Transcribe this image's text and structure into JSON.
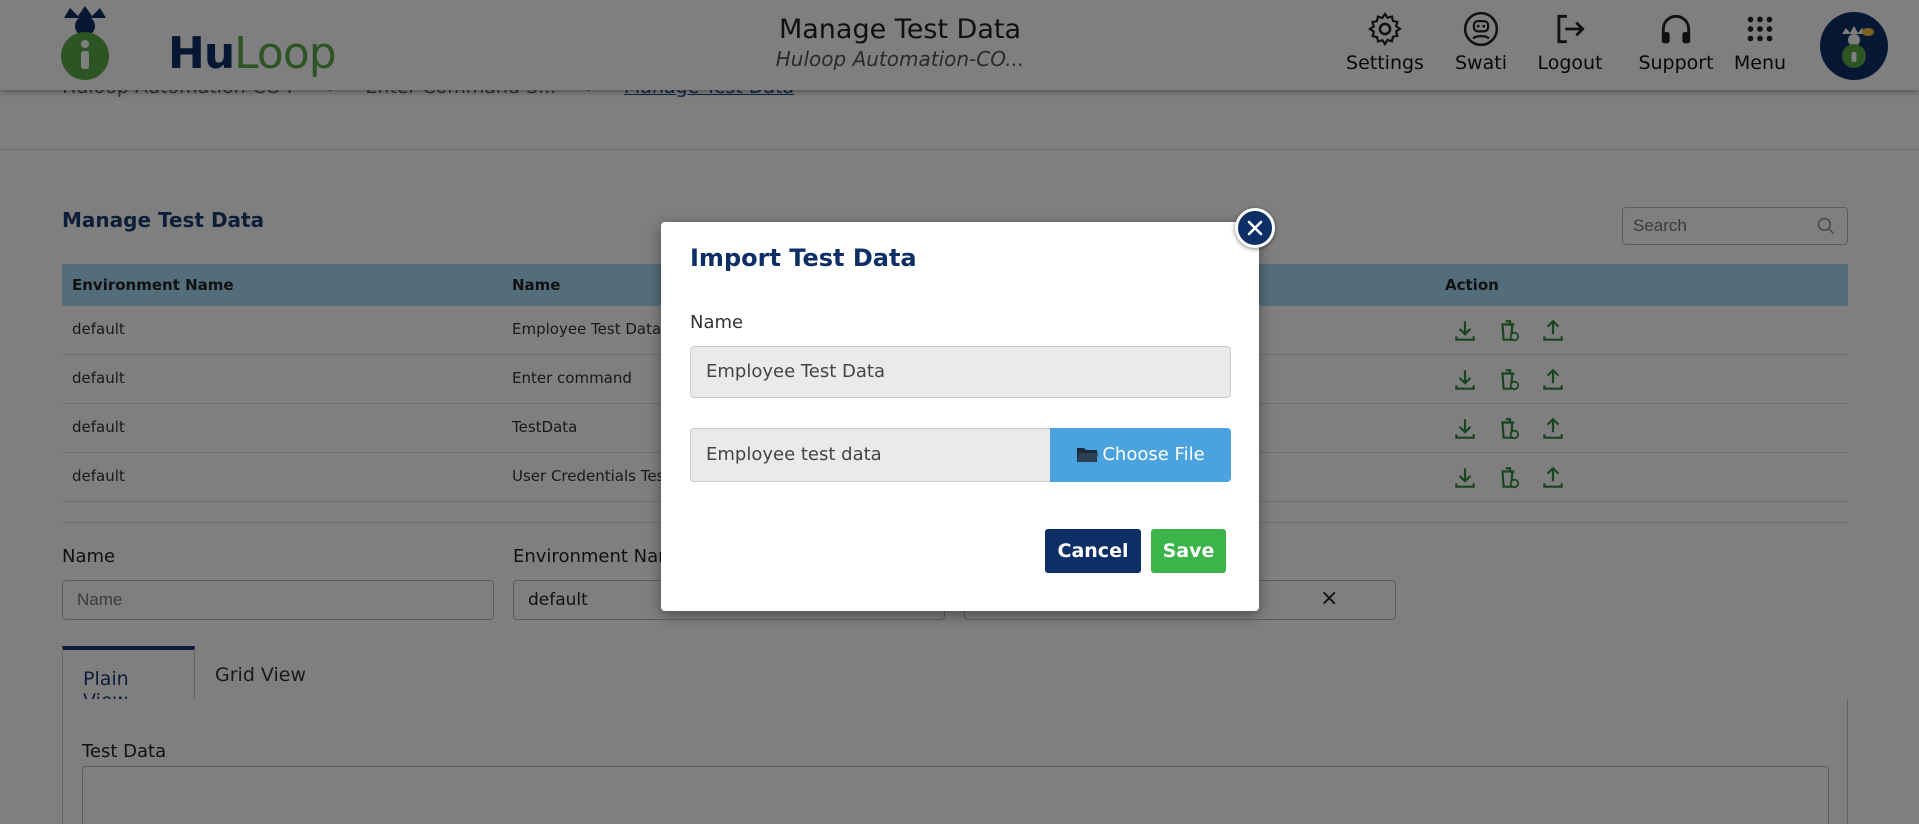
{
  "header": {
    "logo": {
      "part1": "Hu",
      "part2": "Loop"
    },
    "title": "Manage Test Data",
    "subtitle": "Huloop Automation-CO...",
    "nav": [
      {
        "label": "Settings",
        "icon": "gear-icon"
      },
      {
        "label": "Swati",
        "icon": "user-icon"
      },
      {
        "label": "Logout",
        "icon": "logout-icon"
      },
      {
        "label": "Support",
        "icon": "headphones-icon"
      },
      {
        "label": "Menu",
        "icon": "grid-icon"
      }
    ]
  },
  "breadcrumb": [
    "Huloop Automation-CO F",
    "Enter Command S...",
    "Manage Test Data"
  ],
  "page": {
    "section_title": "Manage Test Data",
    "search_placeholder": "Search"
  },
  "table": {
    "columns": [
      "Environment Name",
      "Name",
      "Action"
    ],
    "rows": [
      {
        "env": "default",
        "name": "Employee Test Data"
      },
      {
        "env": "default",
        "name": "Enter command"
      },
      {
        "env": "default",
        "name": "TestData"
      },
      {
        "env": "default",
        "name": "User Credentials Test"
      }
    ]
  },
  "form": {
    "name_label": "Name",
    "name_placeholder": "Name",
    "env_label": "Environment Nam",
    "env_value": "default",
    "clear": "×"
  },
  "tabs": [
    {
      "label": "Plain View",
      "active": true
    },
    {
      "label": "Grid View",
      "active": false
    }
  ],
  "test_data_label": "Test Data",
  "modal": {
    "title": "Import Test Data",
    "name_label": "Name",
    "name_value": "Employee Test Data",
    "file_value": "Employee test data",
    "choose_label": "Choose File",
    "cancel_label": "Cancel",
    "save_label": "Save"
  },
  "colors": {
    "brand_navy": "#0d2f66",
    "brand_green": "#3bb54a",
    "table_header": "#a9dbf5",
    "choose_blue": "#4aa3df",
    "action_icon": "#2e8b3a"
  }
}
